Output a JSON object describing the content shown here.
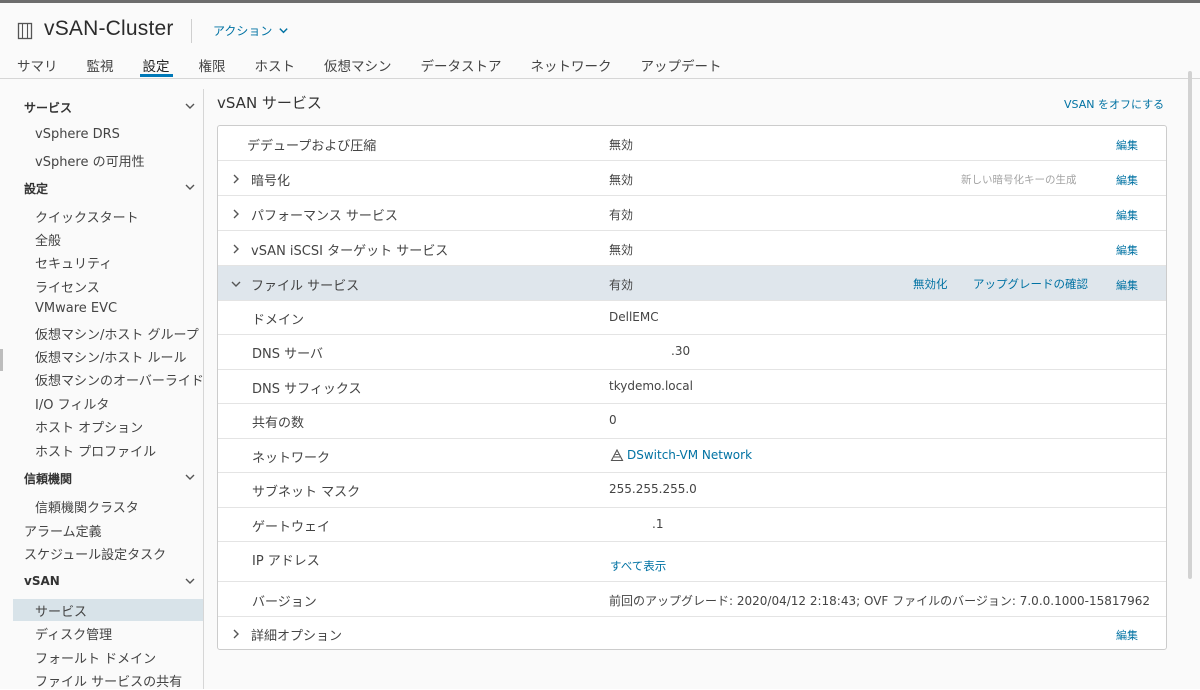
{
  "header": {
    "title": "vSAN-Cluster",
    "actions_label": "アクション"
  },
  "tabs": [
    "サマリ",
    "監視",
    "設定",
    "権限",
    "ホスト",
    "仮想マシン",
    "データストア",
    "ネットワーク",
    "アップデート"
  ],
  "active_tab": "設定",
  "sidebar": {
    "sections": {
      "services": "サービス",
      "settings": "設定",
      "trust": "信頼機関",
      "vsan": "vSAN"
    },
    "services_items": [
      "vSphere DRS",
      "vSphere の可用性"
    ],
    "settings_items": [
      "クイックスタート",
      "全般",
      "セキュリティ",
      "ライセンス",
      "VMware EVC",
      "仮想マシン/ホスト グループ",
      "仮想マシン/ホスト ルール",
      "仮想マシンのオーバーライド",
      "I/O フィルタ",
      "ホスト オプション",
      "ホスト プロファイル"
    ],
    "trust_items": [
      "信頼機関クラスタ"
    ],
    "top_items": [
      "アラーム定義",
      "スケジュール設定タスク"
    ],
    "vsan_items": [
      "サービス",
      "ディスク管理",
      "フォールト ドメイン",
      "ファイル サービスの共有"
    ],
    "selected": "サービス"
  },
  "main": {
    "title": "vSAN サービス",
    "turn_off_link": "VSAN をオフにする",
    "edit_label": "編集",
    "rows": {
      "dedup": {
        "label": "デデュープおよび圧縮",
        "value": "無効"
      },
      "encryption": {
        "label": "暗号化",
        "value": "無効",
        "muted_action": "新しい暗号化キーの生成"
      },
      "performance": {
        "label": "パフォーマンス サービス",
        "value": "有効"
      },
      "iscsi": {
        "label": "vSAN iSCSI ターゲット サービス",
        "value": "無効"
      },
      "file_service": {
        "label": "ファイル サービス",
        "value": "有効",
        "disable_link": "無効化",
        "upgrade_link": "アップグレードの確認"
      },
      "domain": {
        "label": "ドメイン",
        "value": "DellEMC"
      },
      "dns_server": {
        "label": "DNS サーバ",
        "value": ".30"
      },
      "dns_suffix": {
        "label": "DNS サフィックス",
        "value": "tkydemo.local"
      },
      "shares": {
        "label": "共有の数",
        "value": "0"
      },
      "network": {
        "label": "ネットワーク",
        "value": "DSwitch-VM Network",
        "icon": "network-icon"
      },
      "subnet": {
        "label": "サブネット マスク",
        "value": "255.255.255.0"
      },
      "gateway": {
        "label": "ゲートウェイ",
        "value": ".1"
      },
      "ip": {
        "label": "IP アドレス",
        "value": "すべて表示"
      },
      "version": {
        "label": "バージョン",
        "value": "前回のアップグレード: 2020/04/12 2:18:43; OVF ファイルのバージョン: 7.0.0.1000-15817962"
      },
      "advanced": {
        "label": "詳細オプション"
      }
    }
  },
  "colors": {
    "accent": "#0079b8",
    "link": "#0072a3",
    "row_highlight": "#dfe6ec",
    "selection": "#d8e3e9"
  }
}
